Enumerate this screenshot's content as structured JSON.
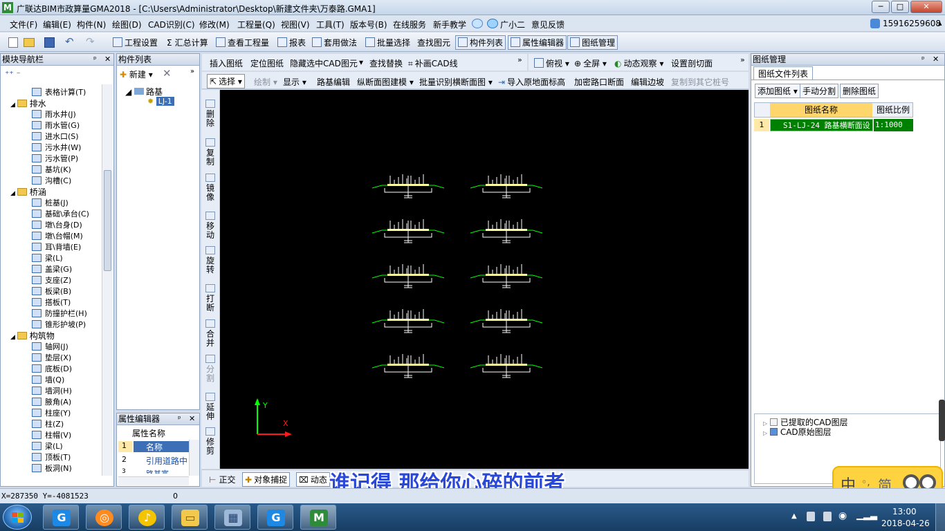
{
  "window": {
    "title": "广联达BIM市政算量GMA2018 - [C:\\Users\\Administrator\\Desktop\\新建文件夹\\万泰路.GMA1]",
    "logo": "M",
    "min": "─",
    "max": "□",
    "close": "✕"
  },
  "menu": [
    "文件(F)",
    "编辑(E)",
    "构件(N)",
    "绘图(D)",
    "CAD识别(C)",
    "修改(M)",
    "工程量(Q)",
    "视图(V)",
    "工具(T)",
    "版本号(B)",
    "在线服务",
    "新手教学",
    "广小二",
    "意见反馈"
  ],
  "account": "15916259608",
  "toolbar": {
    "settings": "工程设置",
    "summary": "汇总计算",
    "view_qty": "查看工程量",
    "report": "报表",
    "apply": "套用做法",
    "batch": "批量选择",
    "find": "查找图元",
    "comp_list": "构件列表",
    "prop_editor": "属性编辑器",
    "drawing_mgr": "图纸管理"
  },
  "nav": {
    "title": "模块导航栏",
    "items": [
      {
        "t": "item",
        "label": "表格计算(T)"
      },
      {
        "t": "group",
        "label": "排水"
      },
      {
        "t": "item",
        "label": "雨水井(J)"
      },
      {
        "t": "item",
        "label": "雨水管(G)"
      },
      {
        "t": "item",
        "label": "进水口(S)"
      },
      {
        "t": "item",
        "label": "污水井(W)"
      },
      {
        "t": "item",
        "label": "污水管(P)"
      },
      {
        "t": "item",
        "label": "基坑(K)"
      },
      {
        "t": "item",
        "label": "沟槽(C)"
      },
      {
        "t": "group",
        "label": "桥涵"
      },
      {
        "t": "item",
        "label": "桩基(J)"
      },
      {
        "t": "item",
        "label": "基础\\承台(C)"
      },
      {
        "t": "item",
        "label": "墩\\台身(D)"
      },
      {
        "t": "item",
        "label": "墩\\台帽(M)"
      },
      {
        "t": "item",
        "label": "耳\\背墙(E)"
      },
      {
        "t": "item",
        "label": "梁(L)"
      },
      {
        "t": "item",
        "label": "盖梁(G)"
      },
      {
        "t": "item",
        "label": "支座(Z)"
      },
      {
        "t": "item",
        "label": "板梁(B)"
      },
      {
        "t": "item",
        "label": "搭板(T)"
      },
      {
        "t": "item",
        "label": "防撞护栏(H)"
      },
      {
        "t": "item",
        "label": "锥形护坡(P)"
      },
      {
        "t": "group",
        "label": "构筑物"
      },
      {
        "t": "item",
        "label": "轴网(J)"
      },
      {
        "t": "item",
        "label": "垫层(X)"
      },
      {
        "t": "item",
        "label": "底板(D)"
      },
      {
        "t": "item",
        "label": "墙(Q)"
      },
      {
        "t": "item",
        "label": "墙洞(H)"
      },
      {
        "t": "item",
        "label": "腋角(A)"
      },
      {
        "t": "item",
        "label": "柱座(Y)"
      },
      {
        "t": "item",
        "label": "柱(Z)"
      },
      {
        "t": "item",
        "label": "柱帽(V)"
      },
      {
        "t": "item",
        "label": "梁(L)"
      },
      {
        "t": "item",
        "label": "顶板(T)"
      },
      {
        "t": "item",
        "label": "板洞(N)"
      }
    ]
  },
  "complist": {
    "title": "构件列表",
    "new": "新建",
    "root": "路基",
    "child": "LJ-1"
  },
  "props": {
    "title": "属性编辑器",
    "header": "属性名称",
    "rows": [
      {
        "n": "1",
        "v": "名称"
      },
      {
        "n": "2",
        "v": "引用道路中"
      },
      {
        "n": "3",
        "v": "路基宽"
      }
    ]
  },
  "cad_toolbar": [
    "插入图纸",
    "定位图纸",
    "隐藏选中CAD图元",
    "查找替换",
    "补画CAD线"
  ],
  "view_toolbar": [
    "俯视",
    "全屏",
    "动态观察",
    "设置剖切面"
  ],
  "draw_toolbar": {
    "select": "选择",
    "draw": "绘制",
    "display": "显示",
    "items": [
      "路基编辑",
      "纵断面图建模",
      "批量识别横断面图",
      "导入原地面标高",
      "加密路口断面",
      "编辑边坡",
      "复制到其它桩号"
    ]
  },
  "vtools": [
    "删除",
    "复制",
    "镜像",
    "移动",
    "旋转",
    "打断",
    "合并",
    "分割",
    "延伸",
    "修剪"
  ],
  "axis": {
    "x": "X",
    "y": "Y"
  },
  "statusbar": {
    "ortho": "正交",
    "snap": "对象捕捉",
    "dynamic": "动态",
    "coords": "X=287350 Y=-4081523",
    "value": "0"
  },
  "subtitle": "谁记得 那给你心碎的前者",
  "drawing_mgr": {
    "title": "图纸管理",
    "tab": "图纸文件列表",
    "add": "添加图纸",
    "split": "手动分割",
    "delete": "删除图纸",
    "col_name": "图纸名称",
    "col_scale": "图纸比例",
    "rows": [
      {
        "idx": "1",
        "name": "S1-LJ-24 路基横断面设",
        "scale": "1:1000"
      }
    ],
    "layers": [
      "已提取的CAD图层",
      "CAD原始图层"
    ]
  },
  "ime": {
    "lang": "中",
    "mode": "简"
  },
  "clock": {
    "time": "13:00",
    "date": "2018-04-26"
  },
  "colors": {
    "canvas": "#000000",
    "title_bg": "#dbe6f4",
    "selected_row": "#008000",
    "ime": "#ffd23f"
  }
}
